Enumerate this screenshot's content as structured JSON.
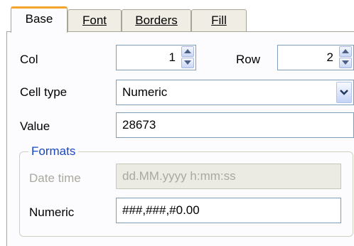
{
  "tabs": [
    {
      "label": "Base",
      "active": true
    },
    {
      "label": "Font",
      "active": false
    },
    {
      "label": "Borders",
      "active": false
    },
    {
      "label": "Fill",
      "active": false
    }
  ],
  "form": {
    "col_label": "Col",
    "col_value": "1",
    "row_label": "Row",
    "row_value": "2",
    "cell_type_label": "Cell type",
    "cell_type_value": "Numeric",
    "value_label": "Value",
    "value_value": "28673"
  },
  "formats": {
    "title": "Formats",
    "date_time_label": "Date time",
    "date_time_value": "dd.MM.yyyy h:mm:ss",
    "date_time_enabled": false,
    "numeric_label": "Numeric",
    "numeric_value": "###,###,#0.00"
  },
  "colors": {
    "active_tab_accent": "#f4a32d",
    "group_title": "#1a47c4",
    "field_border": "#7f9db9"
  }
}
